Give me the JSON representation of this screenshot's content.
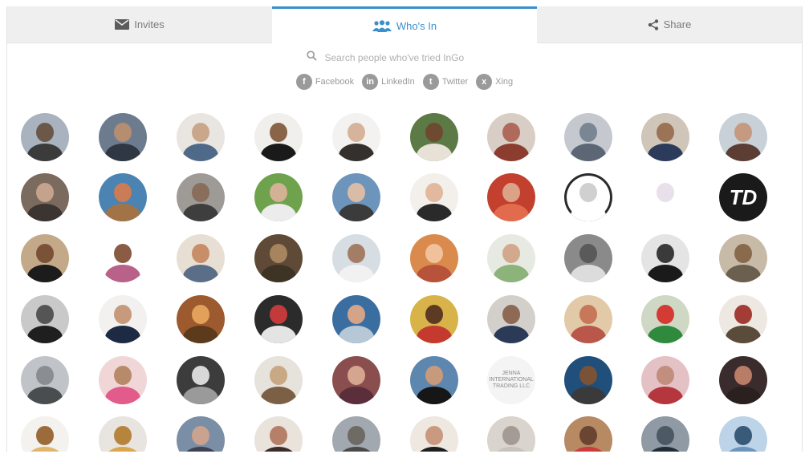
{
  "tabs": [
    {
      "id": "invites",
      "label": "Invites",
      "icon": "envelope-icon",
      "active": false
    },
    {
      "id": "whos-in",
      "label": "Who's In",
      "icon": "people-icon",
      "active": true
    },
    {
      "id": "share",
      "label": "Share",
      "icon": "share-icon",
      "active": false
    }
  ],
  "search": {
    "placeholder": "Search people who've tried InGo"
  },
  "social_filters": [
    {
      "label": "Facebook",
      "glyph": "f",
      "icon": "facebook-icon"
    },
    {
      "label": "LinkedIn",
      "glyph": "in",
      "icon": "linkedin-icon"
    },
    {
      "label": "Twitter",
      "glyph": "t",
      "icon": "twitter-icon"
    },
    {
      "label": "Xing",
      "glyph": "x",
      "icon": "xing-icon"
    }
  ],
  "colors": {
    "accent": "#3a8fcc",
    "tab_inactive_bg": "#efefef",
    "muted_text": "#9a9a9a"
  },
  "avatars": [
    {
      "bg": "#a9b3bf",
      "skin": "#6b5848",
      "shirt": "#3b3b3b"
    },
    {
      "bg": "#6c7c8e",
      "skin": "#b58d70",
      "shirt": "#2f3742"
    },
    {
      "bg": "#e9e6e1",
      "skin": "#caa78b",
      "shirt": "#4f6a88"
    },
    {
      "bg": "#f1efec",
      "skin": "#8a6448",
      "shirt": "#1a1a1a"
    },
    {
      "bg": "#f4f2f0",
      "skin": "#d6b49b",
      "shirt": "#34302e"
    },
    {
      "bg": "#5c7a45",
      "skin": "#6e4a33",
      "shirt": "#e7e1d6"
    },
    {
      "bg": "#d8cec6",
      "skin": "#b06a5c",
      "shirt": "#8c3d2f"
    },
    {
      "bg": "#c5c9cf",
      "skin": "#7b8695",
      "shirt": "#5d6675"
    },
    {
      "bg": "#cfc5b8",
      "skin": "#9b7355",
      "shirt": "#2c3b5c"
    },
    {
      "bg": "#c8d0d8",
      "skin": "#c59a80",
      "shirt": "#5c3d34"
    },
    {
      "bg": "#7b6a5e",
      "skin": "#c5a28c",
      "shirt": "#3c3430"
    },
    {
      "bg": "#4b83b3",
      "skin": "#c97c55",
      "shirt": "#a27347"
    },
    {
      "bg": "#9e9a96",
      "skin": "#8a6e5c",
      "shirt": "#3e3e3e"
    },
    {
      "bg": "#6ea24c",
      "skin": "#d2b195",
      "shirt": "#ececec"
    },
    {
      "bg": "#6d95bc",
      "skin": "#d9bca8",
      "shirt": "#3b3b3b"
    },
    {
      "bg": "#f3f0ec",
      "skin": "#e2b99e",
      "shirt": "#2a2a2a"
    },
    {
      "bg": "#c3402e",
      "skin": "#dba288",
      "shirt": "#e26b4d"
    },
    {
      "bg": "#ffffff",
      "skin": "#d0d0d0",
      "shirt": "#ffffff",
      "ring": "#2a2a2a"
    },
    {
      "bg": "#ffffff",
      "skin": "#e8e0ea",
      "shirt": "#ffffff"
    },
    {
      "bg": "#1a1a1a",
      "text": "TD",
      "text_color": "#ffffff"
    },
    {
      "bg": "#c4a989",
      "skin": "#7a5238",
      "shirt": "#1c1c1c"
    },
    {
      "bg": "#ffffff",
      "skin": "#8a5c44",
      "shirt": "#b8628a"
    },
    {
      "bg": "#e8dfd4",
      "skin": "#c88e6a",
      "shirt": "#5b6e88"
    },
    {
      "bg": "#5e4a36",
      "skin": "#a6845e",
      "shirt": "#3e3426"
    },
    {
      "bg": "#d6dde3",
      "skin": "#a47d66",
      "shirt": "#f1f1f1"
    },
    {
      "bg": "#d98a4c",
      "skin": "#f0c19a",
      "shirt": "#b8533b"
    },
    {
      "bg": "#e7eae3",
      "skin": "#d2a98c",
      "shirt": "#8bb37a"
    },
    {
      "bg": "#8a8a8a",
      "skin": "#5a5a5a",
      "shirt": "#dcdcdc"
    },
    {
      "bg": "#e4e4e4",
      "skin": "#3a3a3a",
      "shirt": "#1a1a1a"
    },
    {
      "bg": "#c7bba8",
      "skin": "#8a6a4c",
      "shirt": "#6b6050"
    },
    {
      "bg": "#c9c9c9",
      "skin": "#555555",
      "shirt": "#1f1f1f"
    },
    {
      "bg": "#f2f1ef",
      "skin": "#c69a7a",
      "shirt": "#1d2a44"
    },
    {
      "bg": "#9c5a2e",
      "skin": "#e2a05a",
      "shirt": "#5c3a1c"
    },
    {
      "bg": "#2b2b2b",
      "skin": "#c23a3a",
      "shirt": "#e4e4e4"
    },
    {
      "bg": "#3a6ea0",
      "skin": "#d4a488",
      "shirt": "#b6c7d6"
    },
    {
      "bg": "#d8b34a",
      "skin": "#5d3a22",
      "shirt": "#c43a2f"
    },
    {
      "bg": "#d3d0cc",
      "skin": "#8e6a55",
      "shirt": "#2b3a57"
    },
    {
      "bg": "#e2c9a8",
      "skin": "#c77858",
      "shirt": "#b8574a"
    },
    {
      "bg": "#cfd8c4",
      "skin": "#d43b34",
      "shirt": "#2f8a3e"
    },
    {
      "bg": "#ede8e1",
      "skin": "#a33c34",
      "shirt": "#5a4b3b"
    },
    {
      "bg": "#c0c4c8",
      "skin": "#8a8e92",
      "shirt": "#4a4d50"
    },
    {
      "bg": "#f0d6d6",
      "skin": "#b78a6a",
      "shirt": "#e25b8a"
    },
    {
      "bg": "#3c3c3c",
      "skin": "#d8d8d8",
      "shirt": "#9a9a9a"
    },
    {
      "bg": "#e6e2dc",
      "skin": "#c9a884",
      "shirt": "#7c6046"
    },
    {
      "bg": "#8a4e4e",
      "skin": "#d6a590",
      "shirt": "#5a2e3a"
    },
    {
      "bg": "#5e87b0",
      "skin": "#c79a7c",
      "shirt": "#161616"
    },
    {
      "bg": "#f4f4f4",
      "text": "JENNA INTERNATIONAL TRADING LLC",
      "text_color": "#8a8a8a",
      "small": true
    },
    {
      "bg": "#1f4f7a",
      "skin": "#7a5238",
      "shirt": "#3a3a3a"
    },
    {
      "bg": "#e4c1c4",
      "skin": "#c28e7e",
      "shirt": "#b5373d"
    },
    {
      "bg": "#3a2c2c",
      "skin": "#b97c66",
      "shirt": "#2a2020"
    },
    {
      "bg": "#f4f2ef",
      "skin": "#9c6b3c",
      "shirt": "#e1b66c"
    },
    {
      "bg": "#e8e4df",
      "skin": "#b7843e",
      "shirt": "#d9a84e"
    },
    {
      "bg": "#7a8ea6",
      "skin": "#c9a290",
      "shirt": "#3e4352"
    },
    {
      "bg": "#e9e3dc",
      "skin": "#b57f68",
      "shirt": "#3b2d2a"
    },
    {
      "bg": "#a2a8b0",
      "skin": "#6e6a64",
      "shirt": "#4b4a48"
    },
    {
      "bg": "#efe8e0",
      "skin": "#c99a80",
      "shirt": "#1f1f1f"
    },
    {
      "bg": "#d9d4ce",
      "skin": "#a49c94",
      "shirt": "#c7c2bc"
    },
    {
      "bg": "#b78a64",
      "skin": "#6a4632",
      "shirt": "#cc3c3c"
    },
    {
      "bg": "#8f9aa4",
      "skin": "#4d5a66",
      "shirt": "#222d38"
    },
    {
      "bg": "#bcd3e8",
      "skin": "#3a5a7a",
      "shirt": "#6c94bc"
    }
  ]
}
